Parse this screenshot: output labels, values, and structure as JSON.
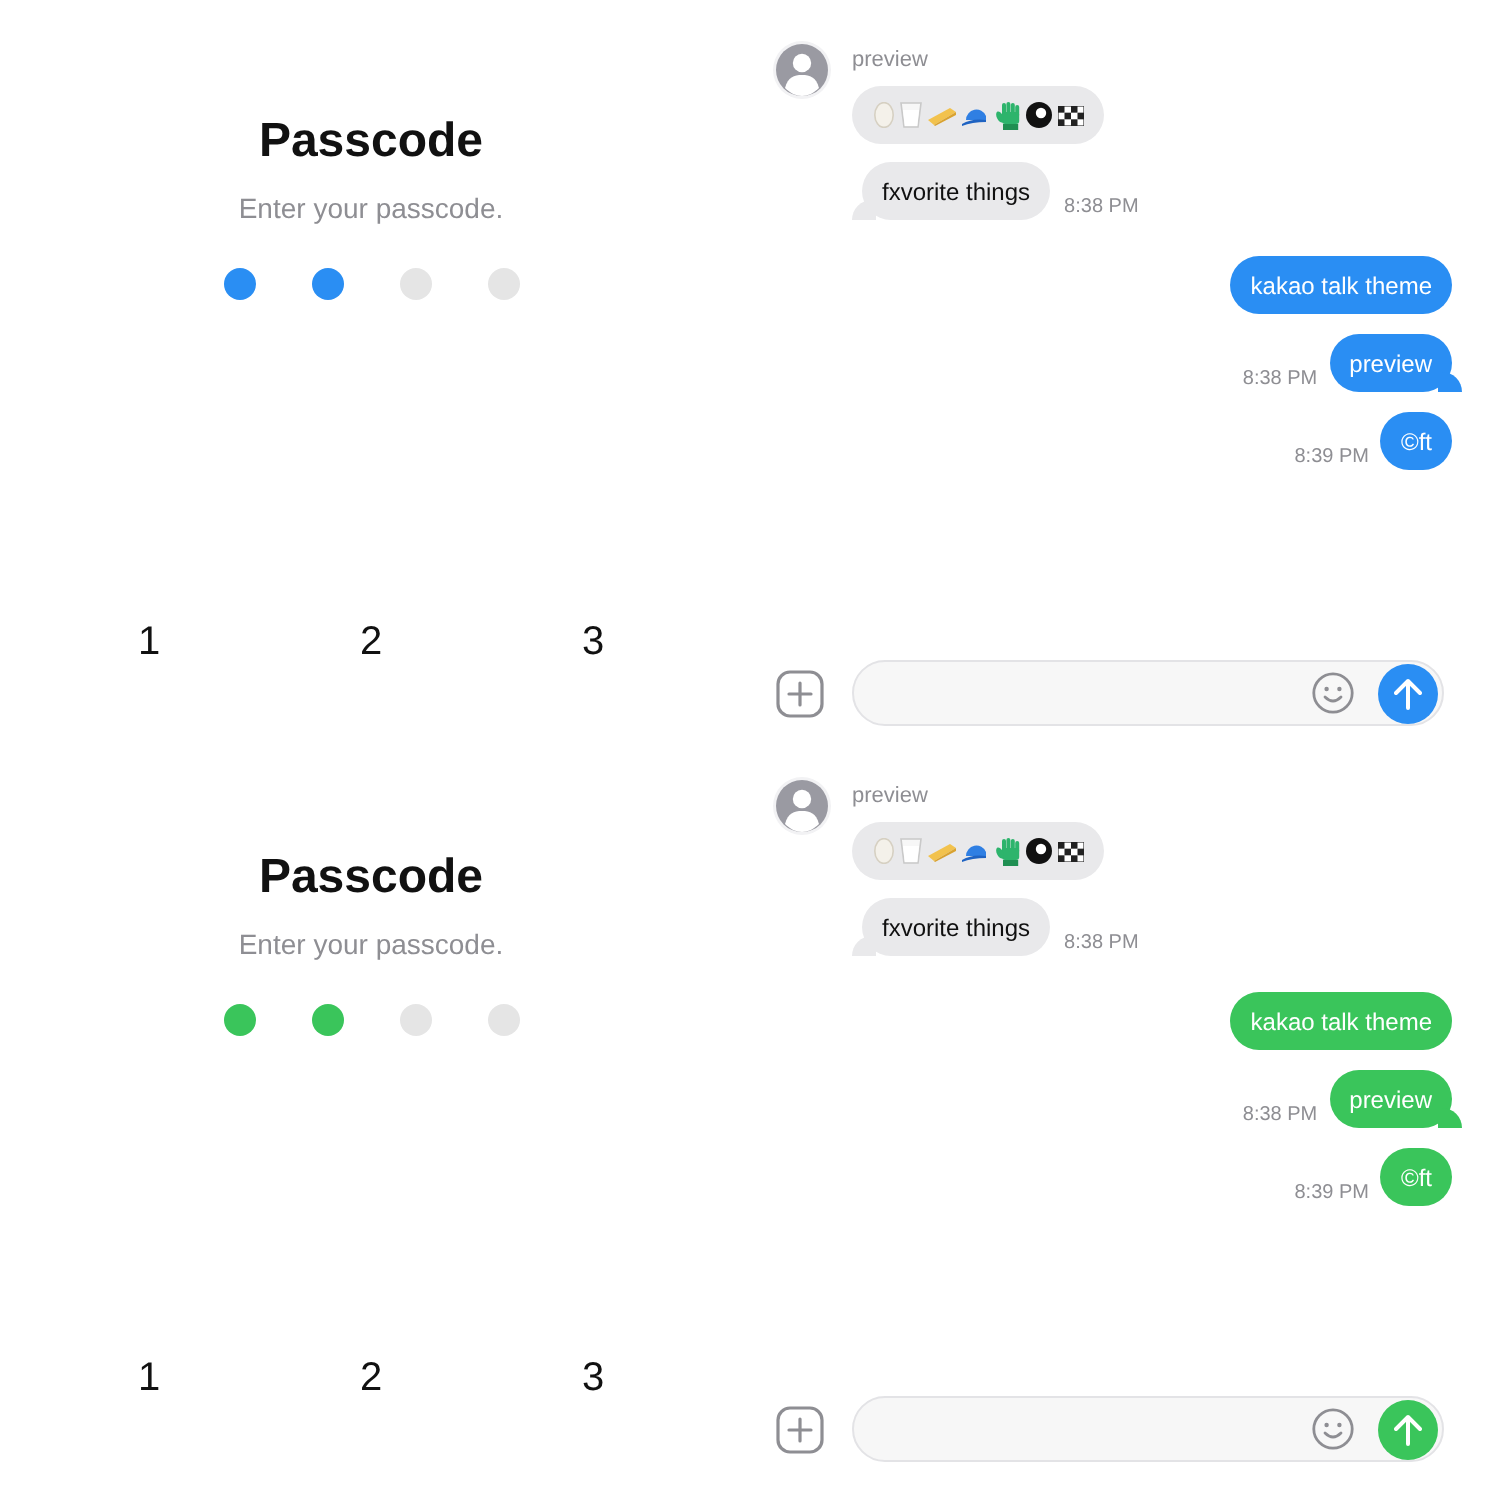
{
  "screens": [
    {
      "color": "#2a8ef3",
      "passcode": {
        "title": "Passcode",
        "subtitle": "Enter your passcode.",
        "dots": [
          {
            "filled": true
          },
          {
            "filled": true
          },
          {
            "filled": false
          },
          {
            "filled": false
          }
        ]
      },
      "keypad": [
        "1",
        "2",
        "3"
      ],
      "chat": {
        "incoming": {
          "sender": "preview",
          "messages": [
            {
              "kind": "emoji",
              "tail": false
            },
            {
              "kind": "text",
              "text": "fxvorite things",
              "time": "8:38 PM",
              "tail": true
            }
          ]
        },
        "outgoing": [
          {
            "text": "kakao talk theme",
            "tail": false
          },
          {
            "text": "preview",
            "time": "8:38 PM",
            "tail": true
          },
          {
            "text": "©ft",
            "time": "8:39 PM",
            "tail": false
          }
        ]
      }
    },
    {
      "color": "#3ac55b",
      "passcode": {
        "title": "Passcode",
        "subtitle": "Enter your passcode.",
        "dots": [
          {
            "filled": true
          },
          {
            "filled": true
          },
          {
            "filled": false
          },
          {
            "filled": false
          }
        ]
      },
      "keypad": [
        "1",
        "2",
        "3"
      ],
      "chat": {
        "incoming": {
          "sender": "preview",
          "messages": [
            {
              "kind": "emoji",
              "tail": false
            },
            {
              "kind": "text",
              "text": "fxvorite things",
              "time": "8:38 PM",
              "tail": true
            }
          ]
        },
        "outgoing": [
          {
            "text": "kakao talk theme",
            "tail": false
          },
          {
            "text": "preview",
            "time": "8:38 PM",
            "tail": true
          },
          {
            "text": "©ft",
            "time": "8:39 PM",
            "tail": false
          }
        ]
      }
    }
  ]
}
